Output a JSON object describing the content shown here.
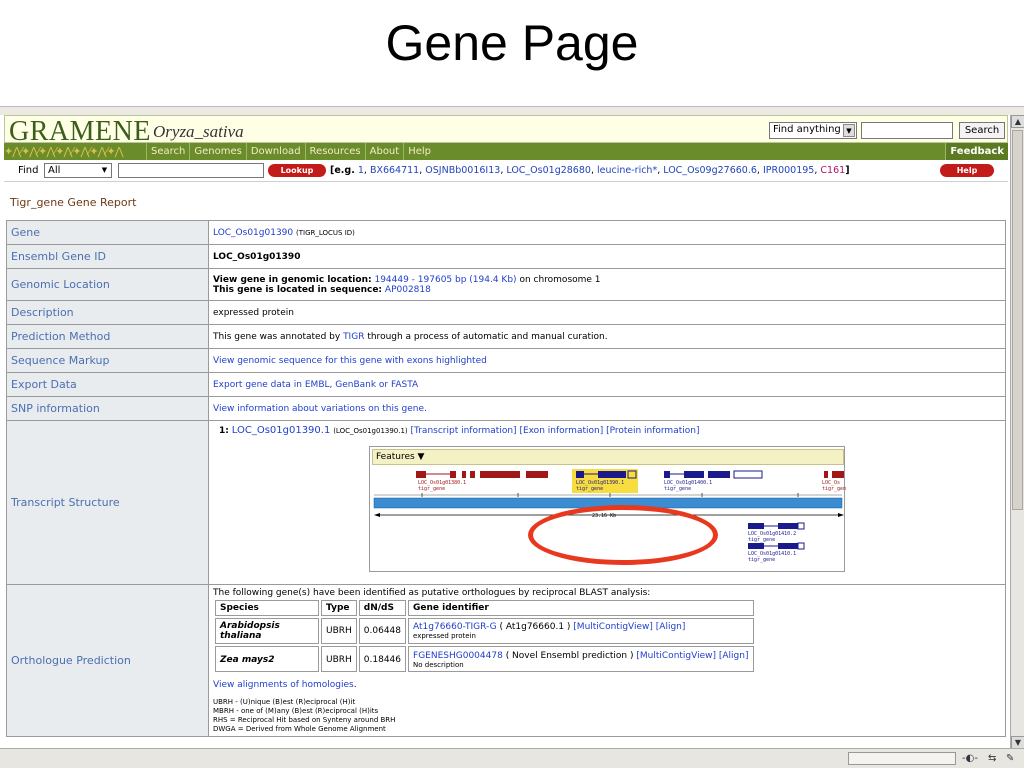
{
  "slide_title": "Gene Page",
  "header": {
    "logo": "GRAMENE",
    "species": "Oryza_sativa",
    "find_anything_label": "Find anything",
    "search_value": "",
    "search_button": "Search"
  },
  "nav": {
    "items": [
      "Search",
      "Genomes",
      "Download",
      "Resources",
      "About",
      "Help"
    ],
    "feedback": "Feedback"
  },
  "findbar": {
    "label": "Find",
    "select_value": "All",
    "input_value": "",
    "lookup_button": "Lookup",
    "examples_prefix": "[e.g.",
    "examples": [
      "1",
      "BX664711",
      "OSJNBb0016I13",
      "LOC_Os01g28680",
      "leucine-rich*",
      "LOC_Os09g27660.6",
      "IPR000195"
    ],
    "examples_last": "C161",
    "examples_suffix": "]",
    "help_button": "Help"
  },
  "report_title": "Tigr_gene Gene Report",
  "rows": {
    "gene": {
      "label": "Gene",
      "link": "LOC_Os01g01390",
      "suffix": "(TIGR_LOCUS ID)"
    },
    "ensembl": {
      "label": "Ensembl Gene ID",
      "value": "LOC_Os01g01390"
    },
    "location": {
      "label": "Genomic Location",
      "line1_prefix": "View gene in genomic location:",
      "line1_link": "194449 - 197605 bp (194.4 Kb)",
      "line1_suffix": "on chromosome 1",
      "line2_prefix": "This gene is located in sequence:",
      "line2_link": "AP002818"
    },
    "description": {
      "label": "Description",
      "value": "expressed protein"
    },
    "prediction": {
      "label": "Prediction Method",
      "prefix": "This gene was annotated by",
      "link": "TIGR",
      "suffix": "through a process of automatic and manual curation."
    },
    "sequence": {
      "label": "Sequence Markup",
      "link": "View genomic sequence for this gene with exons highlighted"
    },
    "export": {
      "label": "Export Data",
      "link": "Export gene data in EMBL, GenBank or FASTA"
    },
    "snp": {
      "label": "SNP information",
      "link": "View information about variations on this gene."
    },
    "transcript": {
      "label": "Transcript Structure",
      "index": "1:",
      "link": "LOC_Os01g01390.1",
      "paren": "(LOC_Os01g01390.1)",
      "transcript_info": "[Transcript information]",
      "exon_info": "[Exon information]",
      "protein_info": "[Protein information]",
      "features_label": "Features ▼",
      "scale_label": "23.16 Kb",
      "track_labels": [
        "LOC_Os01g01380.1",
        "LOC_Os01g01390.1",
        "LOC_Os01g01400.1",
        "LOC_Os",
        "LOC_Os01g01410.2",
        "LOC_Os01g01410.1"
      ],
      "track_sublabel": "tigr_gene"
    },
    "orthologue": {
      "label": "Orthologue Prediction",
      "intro": "The following gene(s) have been identified as putative orthologues by reciprocal BLAST analysis:",
      "headers": [
        "Species",
        "Type",
        "dN/dS",
        "Gene identifier"
      ],
      "entries": [
        {
          "species": "Arabidopsis thaliana",
          "type": "UBRH",
          "dnds": "0.06448",
          "gene_link": "At1g76660-TIGR-G",
          "gene_paren": "( At1g76660.1 )",
          "multicontig": "[MultiContigView]",
          "align": "[Align]",
          "desc": "expressed protein"
        },
        {
          "species": "Zea mays2",
          "type": "UBRH",
          "dnds": "0.18446",
          "gene_link": "FGENESHG0004478",
          "gene_paren": "( Novel Ensembl prediction )",
          "multicontig": "[MultiContigView]",
          "align": "[Align]",
          "desc": "No description"
        }
      ],
      "view_alignments": "View alignments of homologies",
      "legend": [
        "UBRH - (U)nique (B)est (R)eciprocal (H)it",
        "MBRH - one of (M)any (B)est (R)eciprocal (H)its",
        "RHS = Reciprocal Hit based on Synteny around BRH",
        "DWGA = Derived from Whole Genome Alignment"
      ]
    }
  },
  "colors": {
    "header_green": "#6a8c2b",
    "label_blue": "#4a6fb0",
    "link_blue": "#1f3fcc",
    "button_red": "#c31a1a",
    "annotation_red": "#e8391e"
  }
}
